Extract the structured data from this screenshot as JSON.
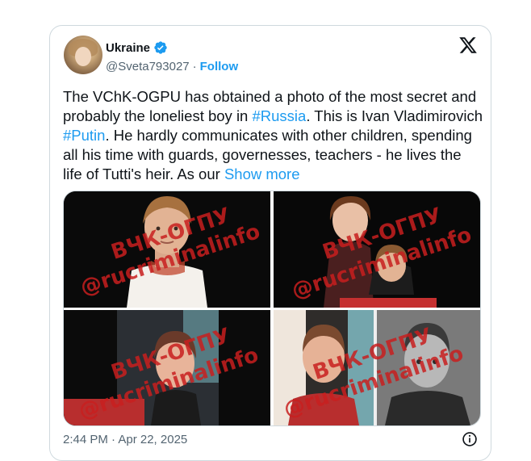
{
  "author": {
    "display_name": "Ukraine",
    "handle": "@Sveta793027",
    "separator": "·",
    "follow_label": "Follow"
  },
  "tweet": {
    "text_1": "The VChK-OGPU has obtained a photo of the most secret and probably the loneliest boy in ",
    "hashtag_1": "#Russia",
    "text_2": ". This is Ivan Vladimirovich ",
    "hashtag_2": "#Putin",
    "text_3": ". He hardly communicates with other children, spending all his time with guards, governesses, teachers - he lives the life of Tutti's heir. As our ",
    "show_more": "Show more"
  },
  "media": {
    "watermark_top": "ВЧК-ОГПУ",
    "watermark_bottom": "@rucriminalinfo"
  },
  "footer": {
    "timestamp": "2:44 PM · Apr 22, 2025"
  },
  "icons": {
    "verified": "verified-badge-icon",
    "x_logo": "x-logo-icon",
    "info": "info-icon"
  },
  "colors": {
    "accent": "#1d9bf0",
    "text": "#0f1419",
    "muted": "#536471"
  }
}
